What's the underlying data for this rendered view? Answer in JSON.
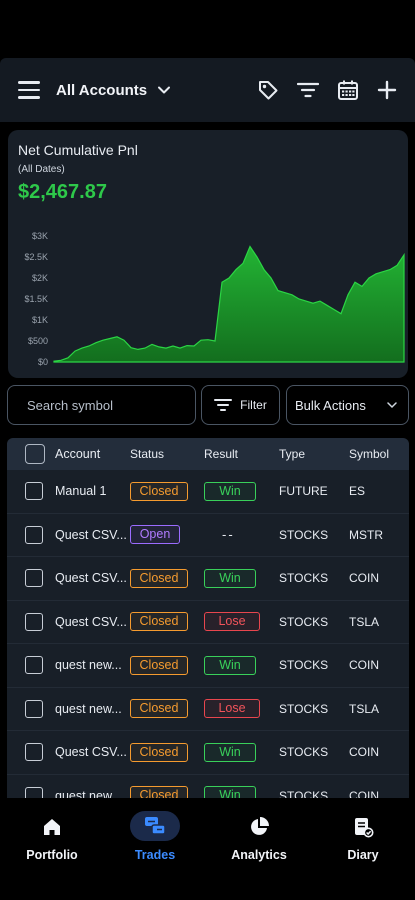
{
  "header": {
    "account_selector": "All Accounts",
    "icons": [
      "hamburger-icon",
      "chevron-down-icon",
      "tag-icon",
      "filter-icon",
      "calendar-icon",
      "plus-icon"
    ]
  },
  "pnl": {
    "title": "Net Cumulative Pnl",
    "subtitle": "(All Dates)",
    "value": "$2,467.87",
    "value_color": "#2ec84a"
  },
  "chart_data": {
    "type": "area",
    "y_tick_labels": [
      "$3K",
      "$2.5K",
      "$2K",
      "$1.5K",
      "$1K",
      "$500",
      "$0"
    ],
    "ylim": [
      0,
      3000
    ],
    "x": [
      0,
      2,
      4,
      6,
      8,
      10,
      12,
      14,
      16,
      18,
      20,
      22,
      24,
      26,
      28,
      30,
      32,
      34,
      36,
      38,
      40,
      42,
      44,
      46,
      48,
      50,
      52,
      54,
      56,
      58,
      60,
      62,
      64,
      66,
      68,
      70,
      72,
      74,
      76,
      78,
      80,
      82,
      84,
      86,
      88,
      90,
      92,
      94,
      96,
      98,
      100
    ],
    "values": [
      20,
      40,
      100,
      260,
      330,
      380,
      460,
      520,
      560,
      600,
      520,
      340,
      300,
      330,
      420,
      360,
      330,
      380,
      330,
      390,
      380,
      520,
      530,
      500,
      1900,
      2000,
      2200,
      2350,
      2750,
      2500,
      2200,
      2000,
      1700,
      1650,
      1600,
      1500,
      1450,
      1400,
      1450,
      1350,
      1250,
      1150,
      1600,
      1900,
      1800,
      2000,
      2100,
      2150,
      2200,
      2300,
      2550
    ],
    "fill_color": "#1f9a2e",
    "grid": false,
    "title": "",
    "xlabel": "",
    "ylabel": ""
  },
  "toolbar": {
    "search_placeholder": "Search symbol",
    "filter_label": "Filter",
    "bulk_actions_label": "Bulk Actions"
  },
  "table": {
    "columns": [
      "Account",
      "Status",
      "Result",
      "Type",
      "Symbol"
    ],
    "rows": [
      {
        "account": "Manual 1",
        "status": "Closed",
        "result": "Win",
        "type": "FUTURE",
        "symbol": "ES"
      },
      {
        "account": "Quest CSV...",
        "status": "Open",
        "result": "--",
        "type": "STOCKS",
        "symbol": "MSTR"
      },
      {
        "account": "Quest CSV...",
        "status": "Closed",
        "result": "Win",
        "type": "STOCKS",
        "symbol": "COIN"
      },
      {
        "account": "Quest CSV...",
        "status": "Closed",
        "result": "Lose",
        "type": "STOCKS",
        "symbol": "TSLA"
      },
      {
        "account": "quest new...",
        "status": "Closed",
        "result": "Win",
        "type": "STOCKS",
        "symbol": "COIN"
      },
      {
        "account": "quest new...",
        "status": "Closed",
        "result": "Lose",
        "type": "STOCKS",
        "symbol": "TSLA"
      },
      {
        "account": "Quest CSV...",
        "status": "Closed",
        "result": "Win",
        "type": "STOCKS",
        "symbol": "COIN"
      },
      {
        "account": "quest new...",
        "status": "Closed",
        "result": "Win",
        "type": "STOCKS",
        "symbol": "COIN"
      }
    ]
  },
  "nav": {
    "items": [
      {
        "label": "Portfolio",
        "icon": "home-icon",
        "active": false
      },
      {
        "label": "Trades",
        "icon": "trades-icon",
        "active": true
      },
      {
        "label": "Analytics",
        "icon": "pie-chart-icon",
        "active": false
      },
      {
        "label": "Diary",
        "icon": "diary-icon",
        "active": false
      }
    ],
    "active_color": "#3b8bff"
  }
}
